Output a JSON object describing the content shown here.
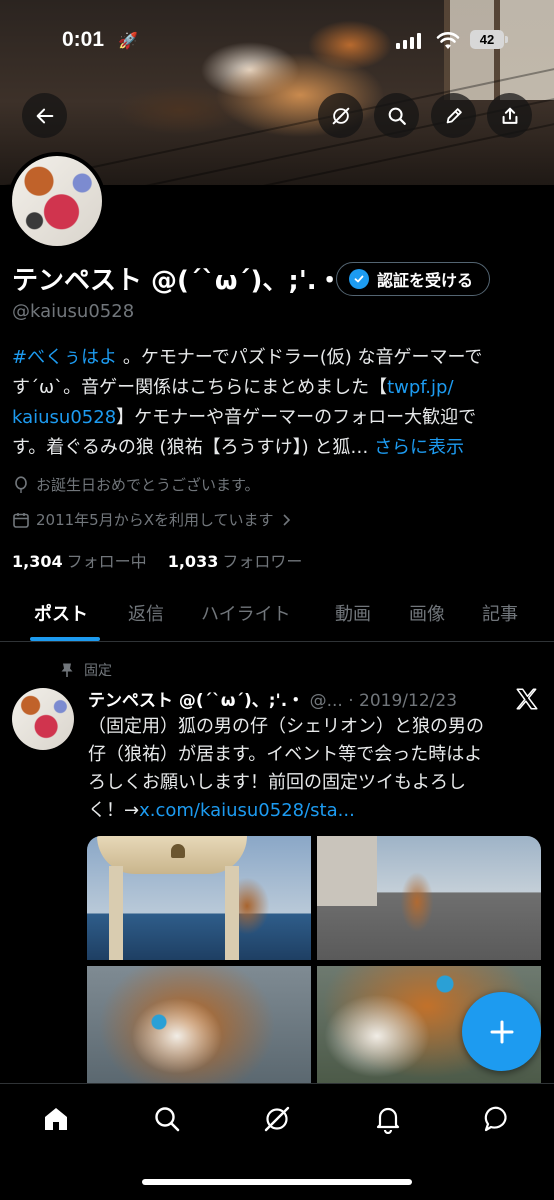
{
  "status_bar": {
    "time": "0:01",
    "battery": "42"
  },
  "profile": {
    "display_name": "テンペスト @(ˊ`ω´)、;'.・",
    "handle": "@kaiusu0528",
    "verify_label": "認証を受ける",
    "bio_lines": [
      {
        "link": "#べくぅはよ",
        "text": " 。ケモナーでパズドラー(仮) な音ゲーマーで"
      },
      {
        "text": "す´ω`。音ゲー関係はこちらにまとめました【",
        "link": "twpf.jp/"
      },
      {
        "link": "kaiusu0528",
        "text": "】ケモナーや音ゲーマーのフォロー大歓迎で"
      },
      {
        "text": "す。着ぐるみの狼 (狼祐【ろうすけ】) と狐…",
        "link": "さらに表示"
      }
    ],
    "birthday": "お誕生日おめでとうございます。",
    "joined": "2011年5月からXを利用しています",
    "following_count": "1,304",
    "following_label": "フォロー中",
    "followers_count": "1,033",
    "followers_label": "フォロワー"
  },
  "tabs": [
    "ポスト",
    "返信",
    "ハイライト",
    "動画",
    "画像",
    "記事"
  ],
  "active_tab": "ポスト",
  "pinned_post": {
    "pinned_label": "固定",
    "author": "テンペスト @(ˊ`ω´)、;'.・",
    "handle": "@...",
    "date": "· 2019/12/23",
    "lines": [
      "（固定用）狐の男の仔（シェリオン）と狼の男の",
      "仔（狼祐）が居ます。イベント等で会った時はよ",
      "ろしくお願いします！前回の固定ツイもよろし"
    ],
    "last_line_prefix": "く！→",
    "last_line_link": "x.com/kaiusu0528/sta..."
  },
  "icons": {
    "back": "arrow-left-icon",
    "grok": "grok-icon",
    "search": "search-icon",
    "edit": "pencil-icon",
    "share": "share-icon",
    "home": "home-icon",
    "notifications": "bell-icon",
    "messages": "message-icon",
    "compose": "plus-icon"
  },
  "colors": {
    "accent": "#1d9bf0",
    "background": "#000000",
    "muted": "#71767b"
  }
}
